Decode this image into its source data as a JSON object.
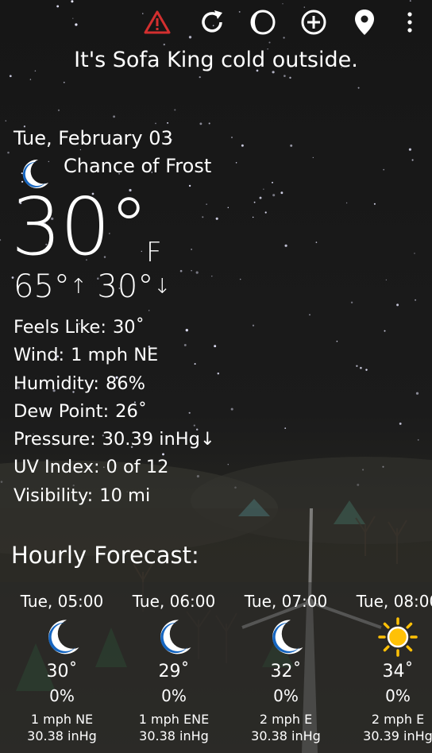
{
  "toolbar": {
    "icons": [
      "warning-icon",
      "refresh-icon",
      "moon-phase-icon",
      "add-location-icon",
      "location-pin-icon",
      "overflow-menu-icon"
    ],
    "warning_color": "#d32f2f"
  },
  "banner": "It's Sofa King cold outside.",
  "current": {
    "date": "Tue, February 03",
    "condition": "Chance of Frost",
    "condition_icon": "crescent-moon-icon",
    "temperature": "30°",
    "unit": "F",
    "high": "65°",
    "low": "30°",
    "high_arrow": "↑",
    "low_arrow": "↓"
  },
  "details": [
    {
      "label": "Feels Like:",
      "value": "30˚"
    },
    {
      "label": "Wind:",
      "value": "1 mph NE"
    },
    {
      "label": "Humidity:",
      "value": "86%"
    },
    {
      "label": "Dew Point:",
      "value": "26˚"
    },
    {
      "label": "Pressure:",
      "value": "30.39 inHg↓"
    },
    {
      "label": "UV Index:",
      "value": "0 of 12"
    },
    {
      "label": "Visibility:",
      "value": "10 mi"
    }
  ],
  "hourly": {
    "title": "Hourly Forecast:",
    "items": [
      {
        "time": "Tue, 05:00",
        "icon": "crescent-moon-icon",
        "temp": "30˚",
        "precip": "0%",
        "wind": "1 mph NE",
        "pressure": "30.38 inHg"
      },
      {
        "time": "Tue, 06:00",
        "icon": "crescent-moon-icon",
        "temp": "29˚",
        "precip": "0%",
        "wind": "1 mph ENE",
        "pressure": "30.38 inHg"
      },
      {
        "time": "Tue, 07:00",
        "icon": "crescent-moon-icon",
        "temp": "32˚",
        "precip": "0%",
        "wind": "2 mph E",
        "pressure": "30.38 inHg"
      },
      {
        "time": "Tue, 08:00",
        "icon": "sun-icon",
        "temp": "34˚",
        "precip": "0%",
        "wind": "2 mph E",
        "pressure": "30.39 inHg"
      }
    ]
  },
  "colors": {
    "moon": "#1565c0",
    "sun": "#ffc107"
  }
}
